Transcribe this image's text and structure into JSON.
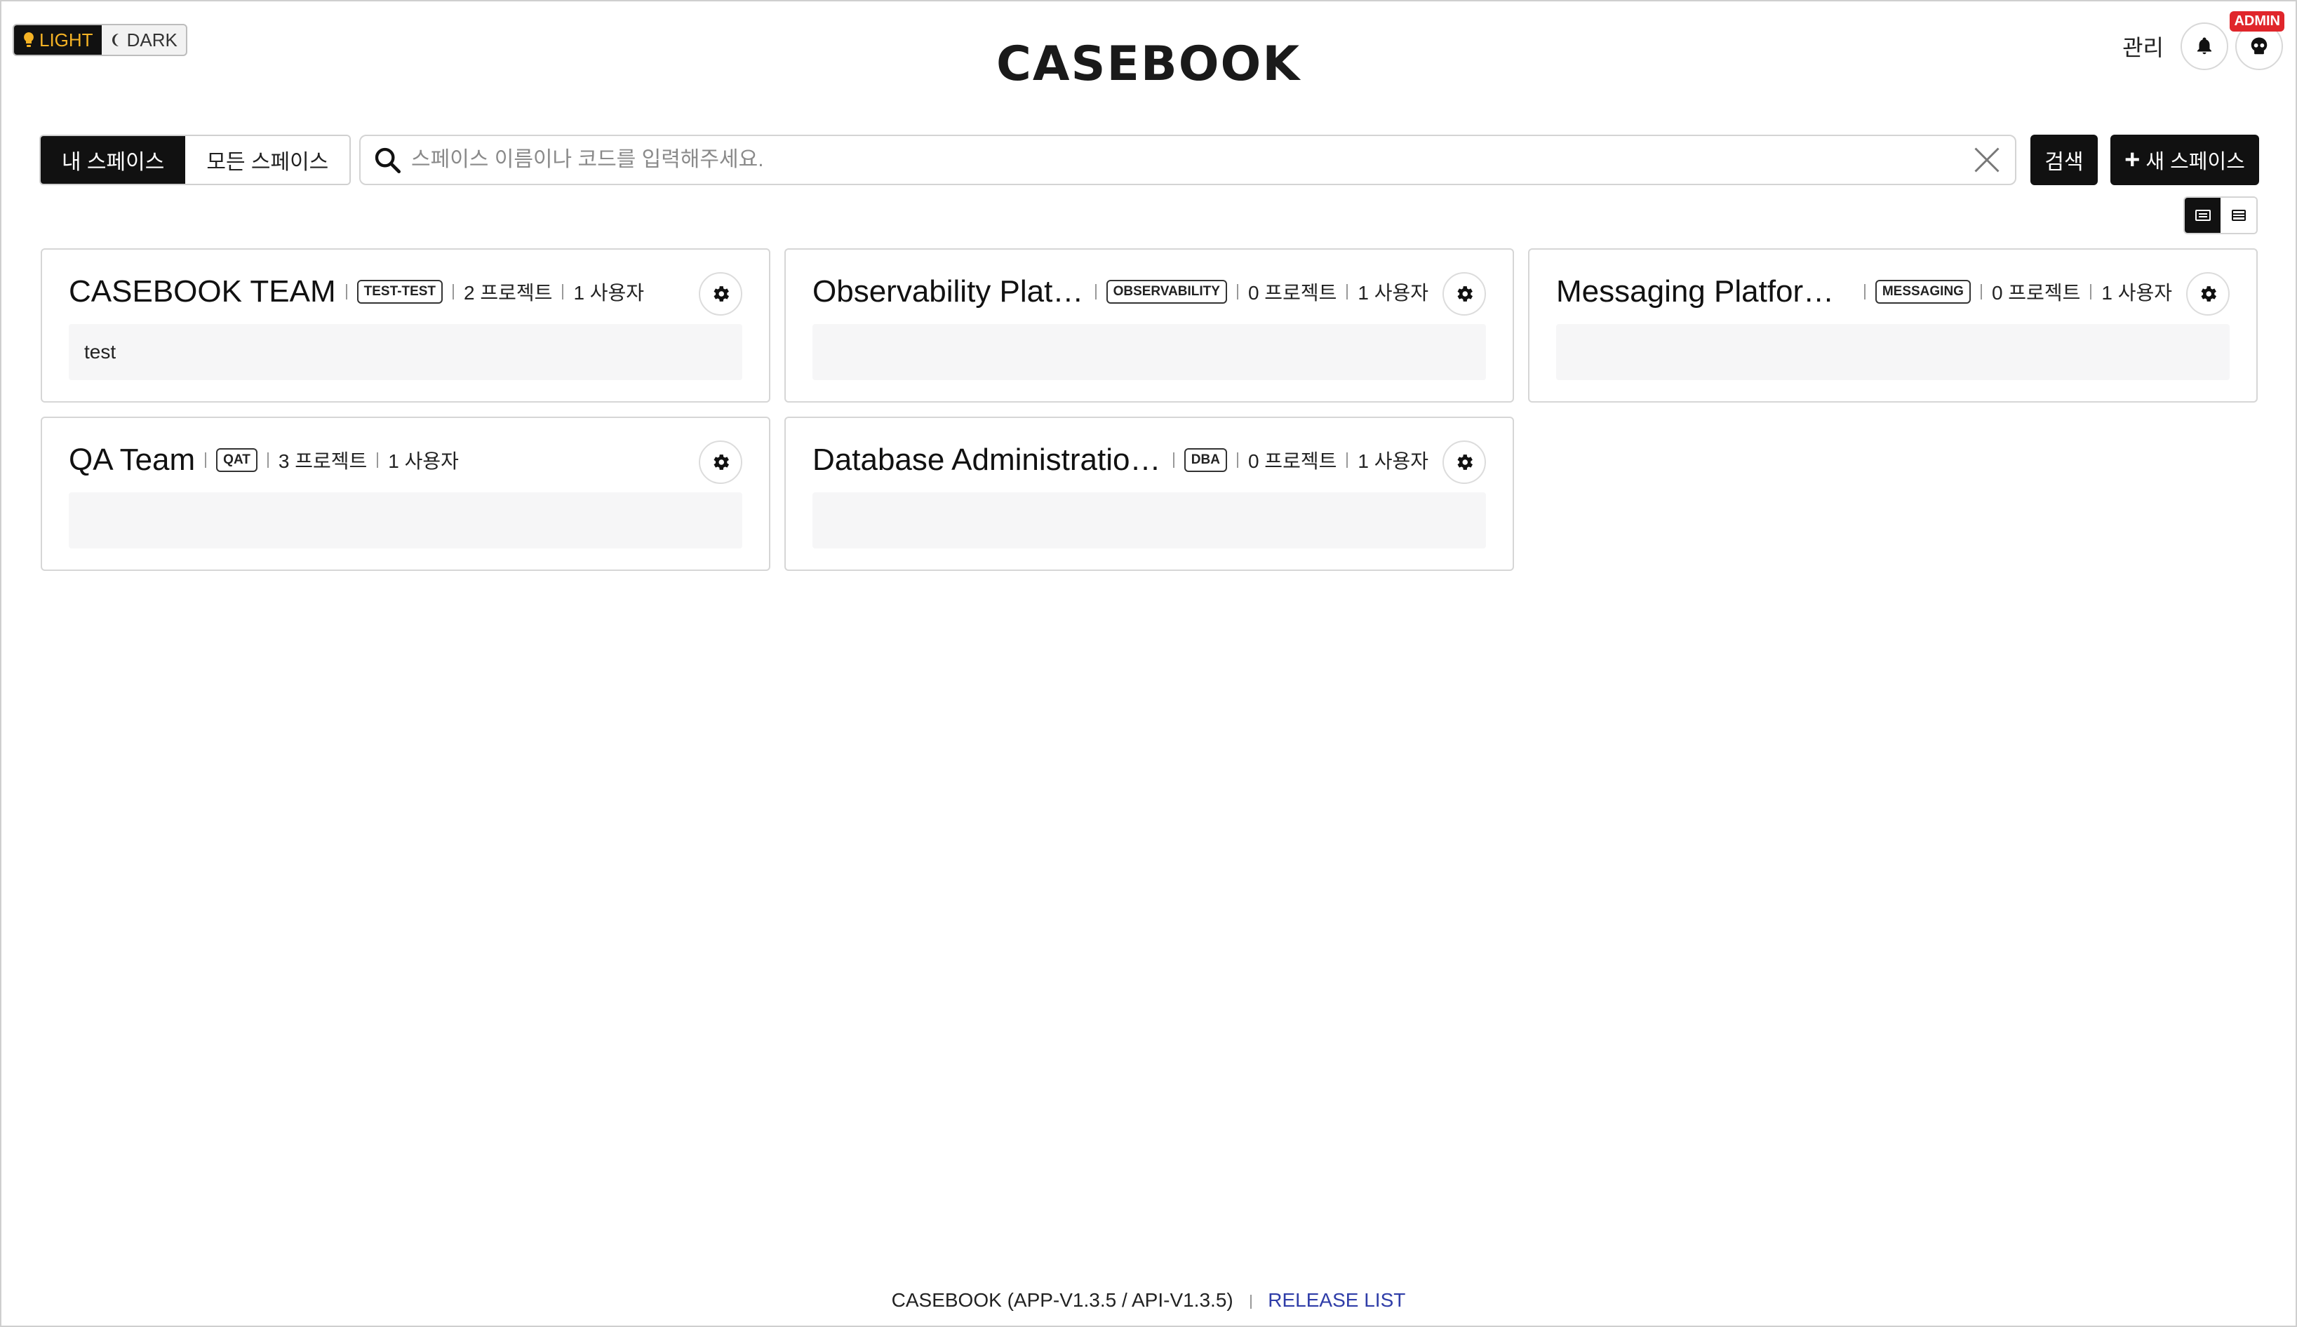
{
  "theme": {
    "light_label": "LIGHT",
    "dark_label": "DARK",
    "active": "light",
    "accent": "#f5b325"
  },
  "header": {
    "logo": "CASEBOOK",
    "admin_link": "관리",
    "bell_icon": "bell-icon",
    "avatar_icon": "skull-icon",
    "admin_badge": "ADMIN",
    "admin_badge_color": "#e0262b"
  },
  "tabs": [
    {
      "label": "내 스페이스",
      "active": true
    },
    {
      "label": "모든 스페이스",
      "active": false
    }
  ],
  "search": {
    "placeholder": "스페이스 이름이나 코드를 입력해주세요.",
    "value": "",
    "button_label": "검색",
    "new_space_label": "새 스페이스"
  },
  "view_mode": {
    "active": "card",
    "options": [
      "card",
      "list"
    ]
  },
  "spaces": [
    {
      "name": "CASEBOOK TEAM",
      "code": "TEST-TEST",
      "projects": "2 프로젝트",
      "users": "1 사용자",
      "description": "test"
    },
    {
      "name": "Observability Platfor...",
      "code": "OBSERVABILITY",
      "projects": "0 프로젝트",
      "users": "1 사용자",
      "description": ""
    },
    {
      "name": "Messaging Platform Te...",
      "code": "MESSAGING",
      "projects": "0 프로젝트",
      "users": "1 사용자",
      "description": ""
    },
    {
      "name": "QA Team",
      "code": "QAT",
      "projects": "3 프로젝트",
      "users": "1 사용자",
      "description": ""
    },
    {
      "name": "Database Administration T...",
      "code": "DBA",
      "projects": "0 프로젝트",
      "users": "1 사용자",
      "description": ""
    }
  ],
  "footer": {
    "version": "CASEBOOK (APP-V1.3.5 / API-V1.3.5)",
    "release_link": "RELEASE LIST",
    "link_color": "#2f3da8"
  }
}
